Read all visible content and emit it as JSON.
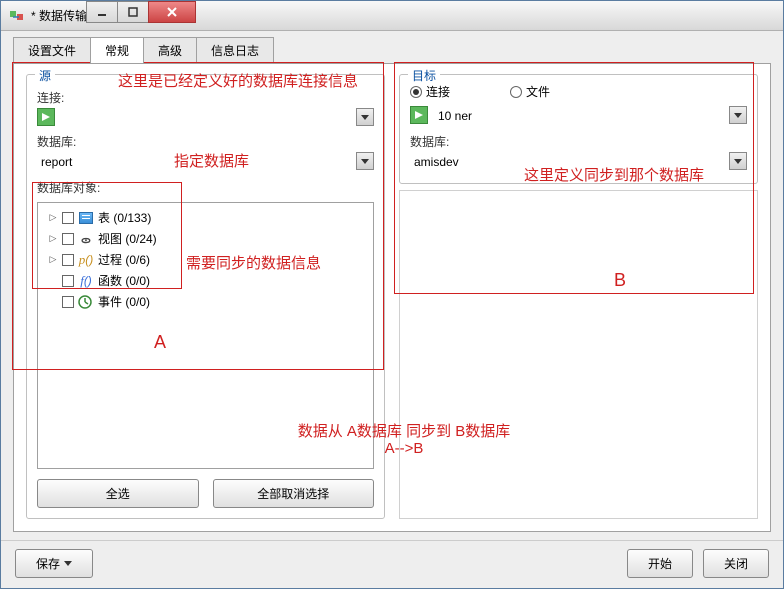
{
  "window": {
    "title": "* 数据传输"
  },
  "tabs": [
    "设置文件",
    "常规",
    "高级",
    "信息日志"
  ],
  "active_tab_index": 1,
  "source": {
    "legend": "源",
    "conn_label": "连接:",
    "conn_value": "",
    "db_label": "数据库:",
    "db_value": "report",
    "obj_label": "数据库对象:",
    "tree": [
      {
        "label": "表  (0/133)",
        "icon": "table",
        "expandable": true
      },
      {
        "label": "视图  (0/24)",
        "icon": "view",
        "expandable": true
      },
      {
        "label": "过程  (0/6)",
        "icon": "proc",
        "expandable": true
      },
      {
        "label": "函数  (0/0)",
        "icon": "func",
        "expandable": false
      },
      {
        "label": "事件  (0/0)",
        "icon": "event",
        "expandable": false
      }
    ],
    "btn_all": "全选",
    "btn_none": "全部取消选择"
  },
  "target": {
    "legend": "目标",
    "radio_conn": "连接",
    "radio_file": "文件",
    "conn_value": "10                                        ner",
    "db_label": "数据库:",
    "db_value": "amisdev"
  },
  "bottom": {
    "save": "保存",
    "start": "开始",
    "close": "关闭"
  },
  "annotations": {
    "src_conn": "这里是已经定义好的数据库连接信息",
    "src_db": "指定数据库",
    "src_obj": "需要同步的数据信息",
    "src_letter": "A",
    "tgt_db": "这里定义同步到那个数据库",
    "tgt_letter": "B",
    "flow1": "数据从 A数据库  同步到  B数据库",
    "flow2": "A-->B"
  }
}
